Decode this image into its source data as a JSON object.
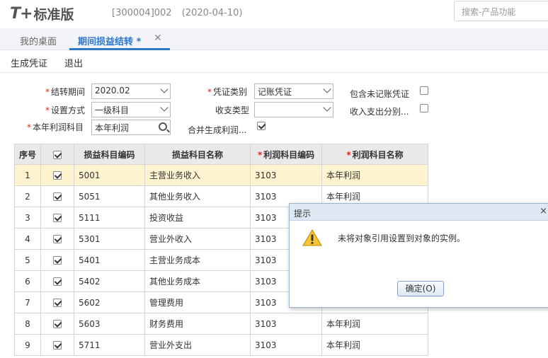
{
  "header": {
    "logo_mark": "T+",
    "logo_text": "标准版",
    "account": "[300004]002",
    "date": "(2020-04-10)",
    "search_placeholder": "搜索-产品功能"
  },
  "tabs": [
    {
      "label": "我的桌面"
    },
    {
      "label": "期间损益结转 *"
    }
  ],
  "toolbar": {
    "generate_label": "生成凭证",
    "exit_label": "退出"
  },
  "form": {
    "period": {
      "label": "结转期间",
      "value": "2020.02"
    },
    "method": {
      "label": "设置方式",
      "value": "一级科目"
    },
    "profit_subject": {
      "label": "本年利润科目",
      "value": "本年利润"
    },
    "voucher_type": {
      "label": "凭证类别",
      "value": "记账凭证"
    },
    "income_expense_type": {
      "label": "收支类型",
      "value": ""
    },
    "merge_generate": {
      "label": "合并生成利润...",
      "checked": true
    },
    "include_unposted": {
      "label": "包含未记账凭证",
      "checked": false
    },
    "split_income_expense": {
      "label": "收入支出分别...",
      "checked": false
    }
  },
  "table": {
    "headers": [
      "序号",
      "",
      "损益科目编码",
      "损益科目名称",
      "利润科目编码",
      "利润科目名称"
    ],
    "rows": [
      {
        "no": "1",
        "checked": true,
        "code": "5001",
        "name": "主营业务收入",
        "pcode": "3103",
        "pname": "本年利润"
      },
      {
        "no": "2",
        "checked": true,
        "code": "5051",
        "name": "其他业务收入",
        "pcode": "3103",
        "pname": "本年利润"
      },
      {
        "no": "3",
        "checked": true,
        "code": "5111",
        "name": "投资收益",
        "pcode": "3103",
        "pname": ""
      },
      {
        "no": "4",
        "checked": true,
        "code": "5301",
        "name": "营业外收入",
        "pcode": "3103",
        "pname": ""
      },
      {
        "no": "5",
        "checked": true,
        "code": "5401",
        "name": "主营业务成本",
        "pcode": "3103",
        "pname": ""
      },
      {
        "no": "6",
        "checked": true,
        "code": "5402",
        "name": "其他业务成本",
        "pcode": "3103",
        "pname": ""
      },
      {
        "no": "7",
        "checked": true,
        "code": "5602",
        "name": "管理费用",
        "pcode": "3103",
        "pname": ""
      },
      {
        "no": "8",
        "checked": true,
        "code": "5603",
        "name": "财务费用",
        "pcode": "3103",
        "pname": "本年利润"
      },
      {
        "no": "9",
        "checked": true,
        "code": "5711",
        "name": "营业外支出",
        "pcode": "3103",
        "pname": "本年利润"
      }
    ]
  },
  "dialog": {
    "title": "提示",
    "close": "×",
    "message": "未将对象引用设置到对象的实例。",
    "ok_label": "确定(O)"
  },
  "colors": {
    "accent": "#2d77cc",
    "highlight_row": "#fdf3cf",
    "required": "#e2231a"
  }
}
